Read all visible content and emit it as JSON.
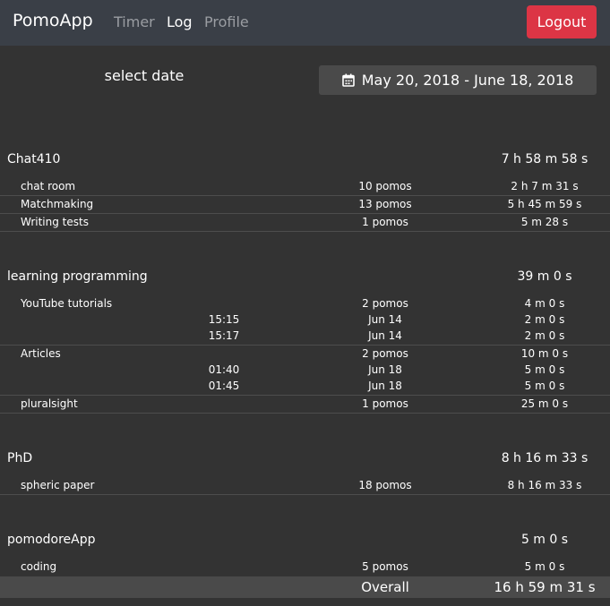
{
  "nav": {
    "brand": "PomoApp",
    "links": [
      "Timer",
      "Log",
      "Profile"
    ],
    "active": "Log",
    "logout": "Logout"
  },
  "filter": {
    "select_label": "select date",
    "date_range": "May 20, 2018 - June 18, 2018"
  },
  "groups": [
    {
      "name": "Chat410",
      "total": "7 h 58 m 58 s",
      "items": [
        {
          "name": "chat room",
          "pomos": "10 pomos",
          "time": "2 h 7 m 31 s"
        },
        {
          "name": "Matchmaking",
          "pomos": "13 pomos",
          "time": "5 h 45 m 59 s"
        },
        {
          "name": "Writing tests",
          "pomos": "1 pomos",
          "time": "5 m 28 s"
        }
      ]
    },
    {
      "name": "learning programming",
      "total": "39 m 0 s",
      "items": [
        {
          "name": "YouTube tutorials",
          "pomos": "2 pomos",
          "time": "4 m 0 s",
          "entries": [
            {
              "clock": "15:15",
              "date": "Jun 14",
              "time": "2 m 0 s"
            },
            {
              "clock": "15:17",
              "date": "Jun 14",
              "time": "2 m 0 s"
            }
          ]
        },
        {
          "name": "Articles",
          "pomos": "2 pomos",
          "time": "10 m 0 s",
          "entries": [
            {
              "clock": "01:40",
              "date": "Jun 18",
              "time": "5 m 0 s"
            },
            {
              "clock": "01:45",
              "date": "Jun 18",
              "time": "5 m 0 s"
            }
          ]
        },
        {
          "name": "pluralsight",
          "pomos": "1 pomos",
          "time": "25 m 0 s"
        }
      ]
    },
    {
      "name": "PhD",
      "total": "8 h 16 m 33 s",
      "items": [
        {
          "name": "spheric paper",
          "pomos": "18 pomos",
          "time": "8 h 16 m 33 s"
        }
      ]
    },
    {
      "name": "pomodoreApp",
      "total": "5 m 0 s",
      "items": [
        {
          "name": "coding",
          "pomos": "5 pomos",
          "time": "5 m 0 s"
        }
      ]
    }
  ],
  "overall": {
    "label": "Overall",
    "total": "16 h 59 m 31 s"
  },
  "colors": {
    "background": "#333333",
    "navbar": "#3a3f47",
    "logout": "#dc3545",
    "panel": "#4a4a4a"
  }
}
